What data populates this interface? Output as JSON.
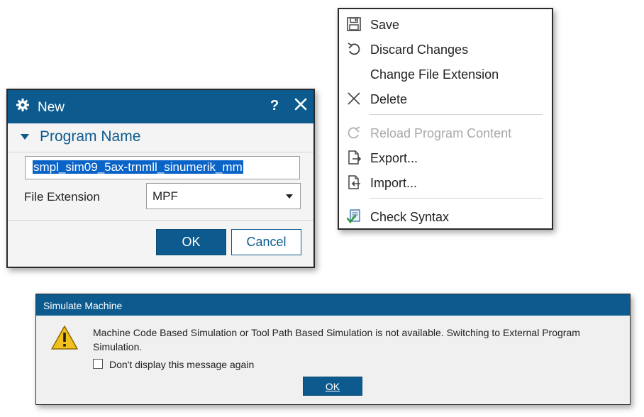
{
  "new_dialog": {
    "title": "New",
    "help_label": "?",
    "section_title": "Program Name",
    "program_name_value": "smpl_sim09_5ax-trnmll_sinumerik_mm",
    "file_extension_label": "File Extension",
    "file_extension_value": "MPF",
    "ok_label": "OK",
    "cancel_label": "Cancel"
  },
  "context_menu": {
    "items": [
      {
        "label": "Save",
        "icon": "save-icon",
        "enabled": true
      },
      {
        "label": "Discard Changes",
        "icon": "undo-icon",
        "enabled": true
      },
      {
        "label": "Change File Extension",
        "icon": "",
        "enabled": true
      },
      {
        "label": "Delete",
        "icon": "delete-x-icon",
        "enabled": true
      },
      {
        "label": "Reload Program Content",
        "icon": "reload-icon",
        "enabled": false
      },
      {
        "label": "Export...",
        "icon": "export-icon",
        "enabled": true
      },
      {
        "label": "Import...",
        "icon": "import-icon",
        "enabled": true
      },
      {
        "label": "Check Syntax",
        "icon": "check-syntax-icon",
        "enabled": true
      }
    ]
  },
  "simulate_dialog": {
    "title": "Simulate Machine",
    "message": "Machine Code Based Simulation or Tool Path Based Simulation is not available. Switching to External Program Simulation.",
    "checkbox_label": "Don't display this message again",
    "checkbox_checked": false,
    "ok_label": "OK"
  },
  "colors": {
    "titlebar": "#0d5b8e",
    "selection": "#0a64c8",
    "disabled_text": "#a8a8a8",
    "warning": "#f2c01e"
  }
}
